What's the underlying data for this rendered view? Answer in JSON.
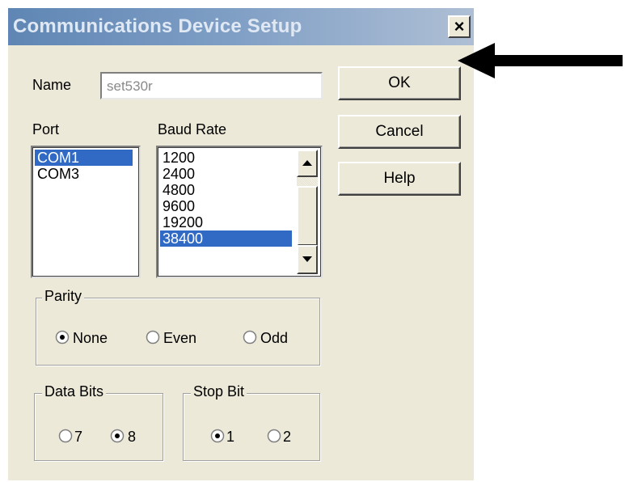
{
  "dialog": {
    "title": "Communications Device Setup",
    "close_label": "×"
  },
  "name_field": {
    "label": "Name",
    "value": "set530r"
  },
  "port": {
    "label": "Port",
    "items": [
      "COM1",
      "COM3"
    ],
    "selected": "COM1"
  },
  "baud": {
    "label": "Baud Rate",
    "items": [
      "1200",
      "2400",
      "4800",
      "9600",
      "19200",
      "38400"
    ],
    "selected": "38400"
  },
  "buttons": {
    "ok": "OK",
    "cancel": "Cancel",
    "help": "Help"
  },
  "parity": {
    "label": "Parity",
    "options": [
      "None",
      "Even",
      "Odd"
    ],
    "selected": "None"
  },
  "data_bits": {
    "label": "Data Bits",
    "options": [
      "7",
      "8"
    ],
    "selected": "8"
  },
  "stop_bit": {
    "label": "Stop Bit",
    "options": [
      "1",
      "2"
    ],
    "selected": "1"
  },
  "colors": {
    "selection": "#316ac5",
    "dialog_bg": "#ece9d8",
    "annotation_arrow": "#000000"
  },
  "annotation": {
    "icon": "arrow-left-icon",
    "points_to": "ok-button"
  }
}
